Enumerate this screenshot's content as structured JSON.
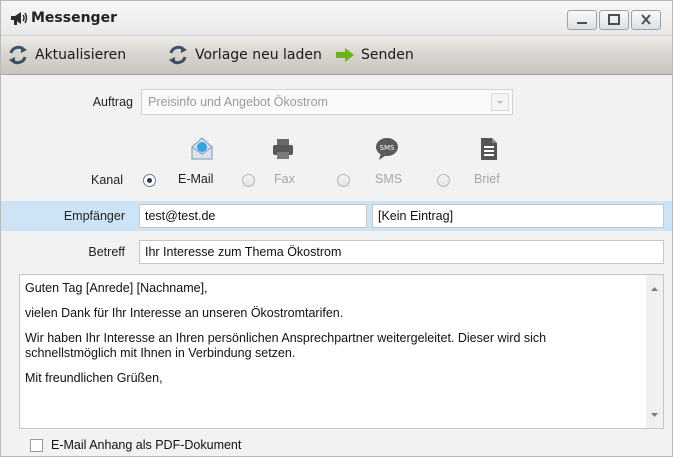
{
  "window": {
    "title": "Messenger",
    "controls": [
      "minimize",
      "maximize",
      "close"
    ]
  },
  "toolbar": {
    "refresh_label": "Aktualisieren",
    "reload_template_label": "Vorlage neu laden",
    "send_label": "Senden"
  },
  "form": {
    "auftrag_label": "Auftrag",
    "auftrag_value": "Preisinfo und Angebot Ökostrom",
    "kanal_label": "Kanal",
    "channels": [
      {
        "label": "E-Mail",
        "selected": true,
        "enabled": true,
        "icon": "email-icon"
      },
      {
        "label": "Fax",
        "selected": false,
        "enabled": false,
        "icon": "fax-icon"
      },
      {
        "label": "SMS",
        "selected": false,
        "enabled": false,
        "icon": "sms-icon"
      },
      {
        "label": "Brief",
        "selected": false,
        "enabled": false,
        "icon": "letter-icon"
      }
    ],
    "recipient_label": "Empfänger",
    "recipient_value": "test@test.de",
    "recipient_secondary_value": "[Kein Eintrag]",
    "subject_label": "Betreff",
    "subject_value": "Ihr Interesse zum Thema Ökostrom"
  },
  "message": {
    "paragraphs": [
      "Guten Tag [Anrede] [Nachname],",
      "vielen Dank für Ihr Interesse an unseren Ökostromtarifen.",
      "Wir haben Ihr Interesse an Ihren persönlichen Ansprechpartner weitergeleitet. Dieser wird sich schnellstmöglich mit Ihnen in Verbindung setzen.",
      "Mit freundlichen Grüßen,"
    ]
  },
  "attachment": {
    "label": "E-Mail Anhang als PDF-Dokument",
    "checked": false
  },
  "colors": {
    "recipient_band": "#cde4f7",
    "send_arrow": "#6fb21c",
    "refresh_icon": "#3d4f63"
  }
}
